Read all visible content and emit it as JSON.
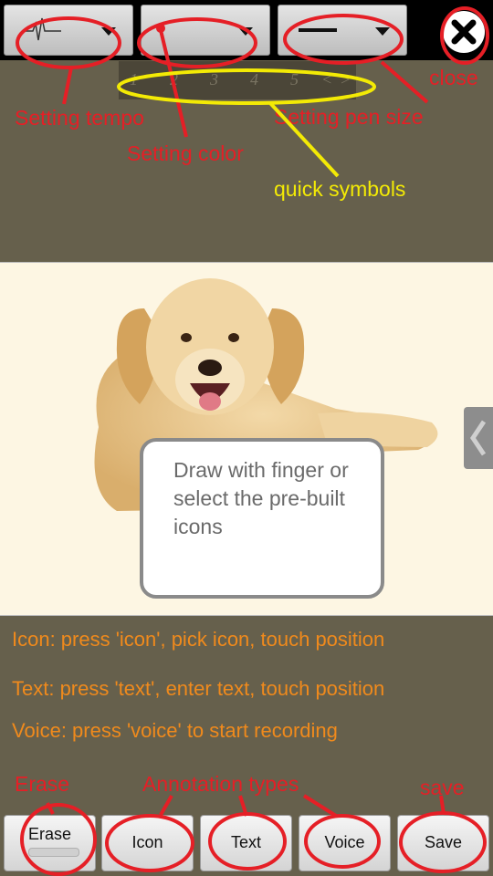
{
  "toolbar": {
    "tempo_icon": "heartbeat-pulse-icon",
    "color_icon": "color-dot-icon",
    "pen_icon": "pen-size-line-icon",
    "close_icon": "close-x-icon"
  },
  "quick_symbols": [
    "1",
    "2",
    "3",
    "4",
    "5",
    "<",
    ">"
  ],
  "callouts": {
    "close": "close",
    "setting_tempo": "Setting tempo",
    "setting_color": "Setting color",
    "setting_pen_size": "Setting pen size",
    "quick_symbols": "quick symbols",
    "erase": "Erase",
    "annotation_types": "Annotation types",
    "save": "save"
  },
  "canvas": {
    "image": "golden-retriever-dog-photo",
    "tooltip": "Draw with  finger or select the pre-built icons"
  },
  "instructions": [
    "Icon: press 'icon', pick icon, touch position",
    "Text: press 'text', enter text, touch position",
    "Voice: press 'voice' to start recording"
  ],
  "bottom_buttons": {
    "erase": "Erase",
    "icon": "Icon",
    "text": "Text",
    "voice": "Voice",
    "save": "Save"
  },
  "colors": {
    "background": "#66604c",
    "annotation_red": "#e51f26",
    "annotation_yellow": "#f3ea05",
    "instruction_orange": "#f08a1c",
    "canvas": "#fdf6e3"
  }
}
